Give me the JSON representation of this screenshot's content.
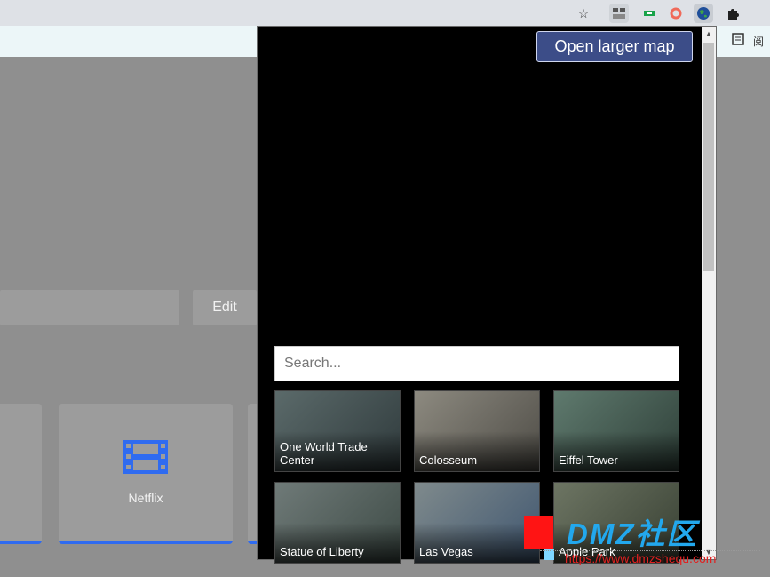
{
  "toolbar": {
    "icons": [
      "star-icon",
      "tab-groups-icon",
      "green-extension-icon",
      "red-ring-extension-icon",
      "earth-extension-icon",
      "puzzle-extensions-icon"
    ]
  },
  "bookmarks": {
    "partial_label": "阅"
  },
  "page": {
    "edit_label": "Edit",
    "tiles": [
      {
        "label": ""
      },
      {
        "label": "Netflix"
      },
      {
        "label": ""
      }
    ],
    "accent": "#2f6bf0"
  },
  "popup": {
    "open_map_label": "Open larger map",
    "search_placeholder": "Search...",
    "places": [
      {
        "label": "One World Trade Center",
        "colors": [
          "#5b6a6a",
          "#2f3a3c"
        ]
      },
      {
        "label": "Colosseum",
        "colors": [
          "#8d8a80",
          "#4e4c46"
        ]
      },
      {
        "label": "Eiffel Tower",
        "colors": [
          "#5f7a6e",
          "#2e3f38"
        ]
      },
      {
        "label": "Statue of Liberty",
        "colors": [
          "#6f7a78",
          "#3d4a45"
        ]
      },
      {
        "label": "Las Vegas",
        "colors": [
          "#7f8a8c",
          "#3f5670"
        ]
      },
      {
        "label": "Apple Park",
        "colors": [
          "#6d7563",
          "#384033"
        ]
      }
    ]
  },
  "watermark": {
    "logo_text": "DMZ社区",
    "url": "https://www.dmzshequ.com"
  }
}
